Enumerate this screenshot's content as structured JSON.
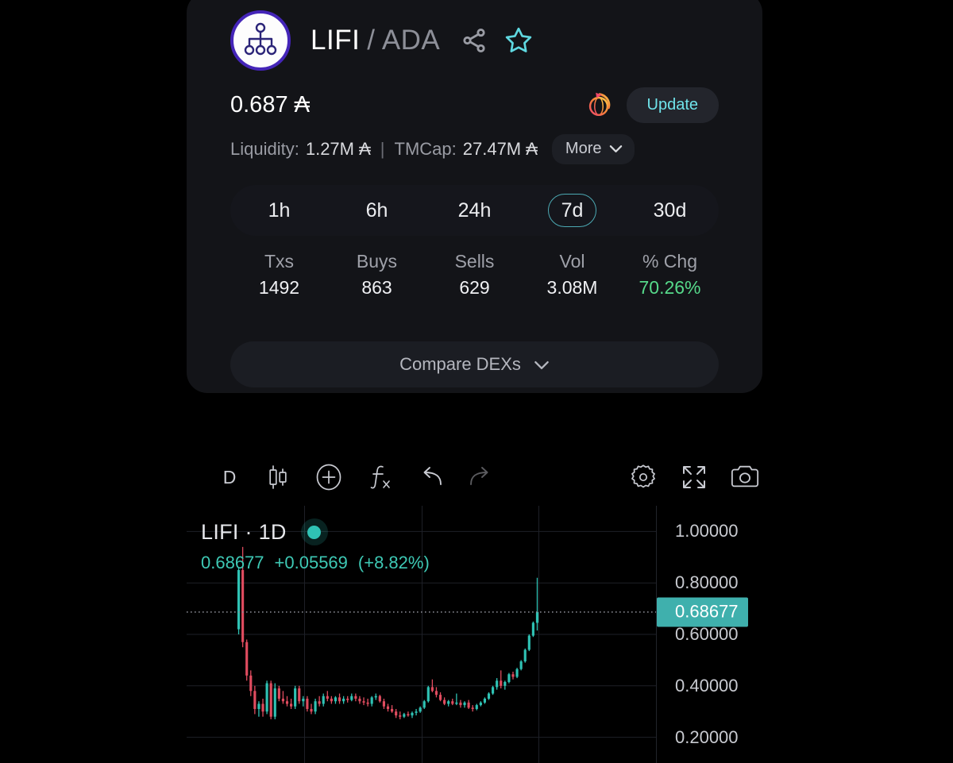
{
  "token_card": {
    "logo_icon": "hierarchy-tree-icon",
    "base_symbol": "LIFI",
    "quote_symbol": "/ ADA",
    "share_icon": "share-icon",
    "favorite_icon": "star-icon",
    "price": "0.687",
    "price_currency_symbol": "₳",
    "dex_icon": "dex-logo-icon",
    "update_label": "Update",
    "liquidity_label": "Liquidity:",
    "liquidity_value": "1.27M ₳",
    "separator": "|",
    "tmcap_label": "TMCap:",
    "tmcap_value": "27.47M ₳",
    "more_label": "More",
    "more_chevron": "chevron-down-icon",
    "timeframes": [
      {
        "label": "1h",
        "active": false
      },
      {
        "label": "6h",
        "active": false
      },
      {
        "label": "24h",
        "active": false
      },
      {
        "label": "7d",
        "active": true
      },
      {
        "label": "30d",
        "active": false
      }
    ],
    "stats": [
      {
        "label": "Txs",
        "value": "1492",
        "positive": false
      },
      {
        "label": "Buys",
        "value": "863",
        "positive": false
      },
      {
        "label": "Sells",
        "value": "629",
        "positive": false
      },
      {
        "label": "Vol",
        "value": "3.08M",
        "positive": false
      },
      {
        "label": "% Chg",
        "value": "70.26%",
        "positive": true
      }
    ],
    "compare_dexs_label": "Compare DEXs",
    "compare_dexs_chevron": "chevron-down-icon",
    "accent_cyan": "#6fe3ea",
    "accent_green": "#56d98a",
    "logo_ring": "#4425b8"
  },
  "chart": {
    "toolbar": [
      {
        "name": "interval-button",
        "label": "D",
        "icon": "text-label",
        "dim": false
      },
      {
        "name": "chart-type-button",
        "label": "",
        "icon": "candlestick-icon",
        "dim": false
      },
      {
        "name": "add-indicator-button",
        "label": "",
        "icon": "plus-circle-icon",
        "dim": false
      },
      {
        "name": "formula-button",
        "label": "",
        "icon": "fx-icon",
        "dim": false
      },
      {
        "name": "undo-button",
        "label": "",
        "icon": "undo-arrow-icon",
        "dim": false
      },
      {
        "name": "redo-button",
        "label": "",
        "icon": "redo-arrow-icon",
        "dim": true
      },
      {
        "name": "settings-button",
        "label": "",
        "icon": "gear-icon",
        "dim": false
      },
      {
        "name": "fullscreen-button",
        "label": "",
        "icon": "fullscreen-icon",
        "dim": false
      },
      {
        "name": "screenshot-button",
        "label": "",
        "icon": "camera-icon",
        "dim": false
      }
    ],
    "legend": {
      "symbol": "LIFI · 1D",
      "last_price": "0.68677",
      "change_abs": "+0.05569",
      "change_pct": "(+8.82%)",
      "dot_color": "#2fc2b4"
    },
    "current_price_tag": "0.68677"
  },
  "chart_data": {
    "type": "candlestick",
    "title": "LIFI · 1D",
    "xlabel": "",
    "ylabel": "",
    "ylim": [
      0.1,
      1.1
    ],
    "grid": true,
    "legend_position": "top-left",
    "price_axis_ticks": [
      "1.00000",
      "0.80000",
      "0.60000",
      "0.40000",
      "0.20000"
    ],
    "price_axis_tick_values": [
      1.0,
      0.8,
      0.6,
      0.4,
      0.2
    ],
    "highlighted_tick": "0.68677",
    "highlighted_tick_value": 0.68677,
    "last_price": 0.68677,
    "change_abs": 0.05569,
    "change_pct": 8.82,
    "up_color": "#2fc2b4",
    "down_color": "#e04c5f",
    "vertical_gridlines": 3,
    "candles": [
      {
        "o": 0.62,
        "h": 0.86,
        "l": 0.6,
        "c": 0.85
      },
      {
        "o": 0.85,
        "h": 0.94,
        "l": 0.55,
        "c": 0.57
      },
      {
        "o": 0.57,
        "h": 0.58,
        "l": 0.42,
        "c": 0.44
      },
      {
        "o": 0.44,
        "h": 0.46,
        "l": 0.36,
        "c": 0.38
      },
      {
        "o": 0.38,
        "h": 0.4,
        "l": 0.29,
        "c": 0.31
      },
      {
        "o": 0.31,
        "h": 0.34,
        "l": 0.28,
        "c": 0.33
      },
      {
        "o": 0.33,
        "h": 0.35,
        "l": 0.28,
        "c": 0.3
      },
      {
        "o": 0.3,
        "h": 0.42,
        "l": 0.29,
        "c": 0.41
      },
      {
        "o": 0.41,
        "h": 0.42,
        "l": 0.27,
        "c": 0.28
      },
      {
        "o": 0.28,
        "h": 0.41,
        "l": 0.27,
        "c": 0.39
      },
      {
        "o": 0.39,
        "h": 0.4,
        "l": 0.34,
        "c": 0.35
      },
      {
        "o": 0.35,
        "h": 0.38,
        "l": 0.33,
        "c": 0.34
      },
      {
        "o": 0.34,
        "h": 0.36,
        "l": 0.32,
        "c": 0.33
      },
      {
        "o": 0.33,
        "h": 0.35,
        "l": 0.31,
        "c": 0.32
      },
      {
        "o": 0.32,
        "h": 0.4,
        "l": 0.31,
        "c": 0.39
      },
      {
        "o": 0.39,
        "h": 0.4,
        "l": 0.33,
        "c": 0.34
      },
      {
        "o": 0.34,
        "h": 0.36,
        "l": 0.32,
        "c": 0.35
      },
      {
        "o": 0.35,
        "h": 0.36,
        "l": 0.3,
        "c": 0.31
      },
      {
        "o": 0.31,
        "h": 0.33,
        "l": 0.29,
        "c": 0.3
      },
      {
        "o": 0.3,
        "h": 0.35,
        "l": 0.29,
        "c": 0.34
      },
      {
        "o": 0.34,
        "h": 0.36,
        "l": 0.32,
        "c": 0.33
      },
      {
        "o": 0.33,
        "h": 0.37,
        "l": 0.32,
        "c": 0.36
      },
      {
        "o": 0.36,
        "h": 0.38,
        "l": 0.34,
        "c": 0.35
      },
      {
        "o": 0.35,
        "h": 0.36,
        "l": 0.33,
        "c": 0.34
      },
      {
        "o": 0.34,
        "h": 0.36,
        "l": 0.33,
        "c": 0.355
      },
      {
        "o": 0.355,
        "h": 0.37,
        "l": 0.33,
        "c": 0.34
      },
      {
        "o": 0.34,
        "h": 0.36,
        "l": 0.33,
        "c": 0.35
      },
      {
        "o": 0.35,
        "h": 0.36,
        "l": 0.335,
        "c": 0.345
      },
      {
        "o": 0.345,
        "h": 0.37,
        "l": 0.34,
        "c": 0.36
      },
      {
        "o": 0.36,
        "h": 0.37,
        "l": 0.34,
        "c": 0.35
      },
      {
        "o": 0.35,
        "h": 0.36,
        "l": 0.33,
        "c": 0.34
      },
      {
        "o": 0.34,
        "h": 0.355,
        "l": 0.325,
        "c": 0.335
      },
      {
        "o": 0.335,
        "h": 0.35,
        "l": 0.32,
        "c": 0.33
      },
      {
        "o": 0.33,
        "h": 0.36,
        "l": 0.32,
        "c": 0.355
      },
      {
        "o": 0.355,
        "h": 0.37,
        "l": 0.345,
        "c": 0.36
      },
      {
        "o": 0.36,
        "h": 0.365,
        "l": 0.335,
        "c": 0.34
      },
      {
        "o": 0.34,
        "h": 0.35,
        "l": 0.31,
        "c": 0.32
      },
      {
        "o": 0.32,
        "h": 0.33,
        "l": 0.3,
        "c": 0.31
      },
      {
        "o": 0.31,
        "h": 0.325,
        "l": 0.295,
        "c": 0.3
      },
      {
        "o": 0.3,
        "h": 0.31,
        "l": 0.275,
        "c": 0.285
      },
      {
        "o": 0.285,
        "h": 0.3,
        "l": 0.27,
        "c": 0.28
      },
      {
        "o": 0.28,
        "h": 0.295,
        "l": 0.275,
        "c": 0.29
      },
      {
        "o": 0.29,
        "h": 0.3,
        "l": 0.28,
        "c": 0.285
      },
      {
        "o": 0.285,
        "h": 0.3,
        "l": 0.275,
        "c": 0.295
      },
      {
        "o": 0.295,
        "h": 0.31,
        "l": 0.285,
        "c": 0.3
      },
      {
        "o": 0.3,
        "h": 0.32,
        "l": 0.295,
        "c": 0.315
      },
      {
        "o": 0.315,
        "h": 0.345,
        "l": 0.31,
        "c": 0.34
      },
      {
        "o": 0.34,
        "h": 0.4,
        "l": 0.335,
        "c": 0.395
      },
      {
        "o": 0.395,
        "h": 0.425,
        "l": 0.375,
        "c": 0.38
      },
      {
        "o": 0.38,
        "h": 0.395,
        "l": 0.355,
        "c": 0.365
      },
      {
        "o": 0.365,
        "h": 0.375,
        "l": 0.34,
        "c": 0.345
      },
      {
        "o": 0.345,
        "h": 0.355,
        "l": 0.325,
        "c": 0.33
      },
      {
        "o": 0.33,
        "h": 0.345,
        "l": 0.32,
        "c": 0.34
      },
      {
        "o": 0.34,
        "h": 0.35,
        "l": 0.325,
        "c": 0.33
      },
      {
        "o": 0.33,
        "h": 0.37,
        "l": 0.325,
        "c": 0.335
      },
      {
        "o": 0.335,
        "h": 0.345,
        "l": 0.315,
        "c": 0.325
      },
      {
        "o": 0.325,
        "h": 0.34,
        "l": 0.315,
        "c": 0.335
      },
      {
        "o": 0.335,
        "h": 0.345,
        "l": 0.31,
        "c": 0.315
      },
      {
        "o": 0.315,
        "h": 0.325,
        "l": 0.3,
        "c": 0.31
      },
      {
        "o": 0.31,
        "h": 0.33,
        "l": 0.305,
        "c": 0.325
      },
      {
        "o": 0.325,
        "h": 0.34,
        "l": 0.32,
        "c": 0.335
      },
      {
        "o": 0.335,
        "h": 0.355,
        "l": 0.33,
        "c": 0.35
      },
      {
        "o": 0.35,
        "h": 0.375,
        "l": 0.345,
        "c": 0.37
      },
      {
        "o": 0.37,
        "h": 0.4,
        "l": 0.365,
        "c": 0.395
      },
      {
        "o": 0.395,
        "h": 0.43,
        "l": 0.385,
        "c": 0.42
      },
      {
        "o": 0.42,
        "h": 0.46,
        "l": 0.39,
        "c": 0.4
      },
      {
        "o": 0.4,
        "h": 0.42,
        "l": 0.385,
        "c": 0.415
      },
      {
        "o": 0.415,
        "h": 0.45,
        "l": 0.41,
        "c": 0.445
      },
      {
        "o": 0.445,
        "h": 0.455,
        "l": 0.425,
        "c": 0.435
      },
      {
        "o": 0.435,
        "h": 0.47,
        "l": 0.43,
        "c": 0.465
      },
      {
        "o": 0.465,
        "h": 0.5,
        "l": 0.46,
        "c": 0.495
      },
      {
        "o": 0.495,
        "h": 0.545,
        "l": 0.49,
        "c": 0.54
      },
      {
        "o": 0.54,
        "h": 0.6,
        "l": 0.535,
        "c": 0.595
      },
      {
        "o": 0.595,
        "h": 0.65,
        "l": 0.59,
        "c": 0.645
      },
      {
        "o": 0.645,
        "h": 0.82,
        "l": 0.615,
        "c": 0.687
      }
    ]
  }
}
